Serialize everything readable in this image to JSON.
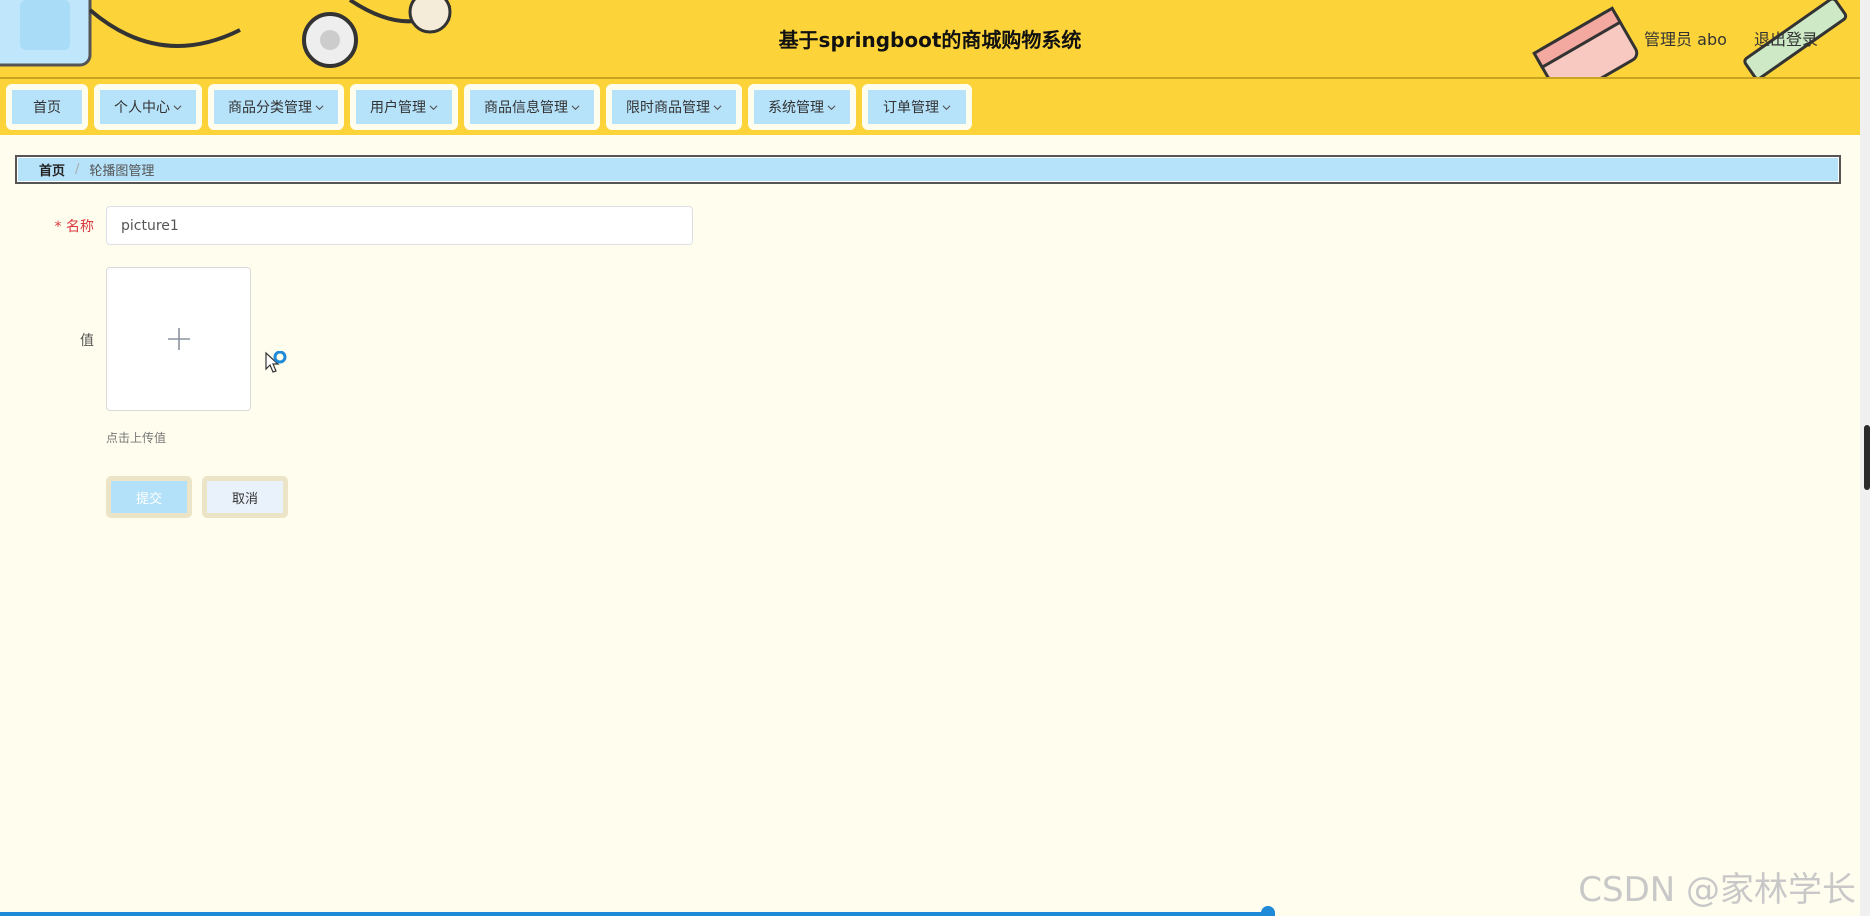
{
  "header": {
    "title": "基于springboot的商城购物系统",
    "user_label": "管理员 abo",
    "logout_label": "退出登录"
  },
  "nav": {
    "items": [
      {
        "label": "首页"
      },
      {
        "label": "个人中心"
      },
      {
        "label": "商品分类管理"
      },
      {
        "label": "用户管理"
      },
      {
        "label": "商品信息管理"
      },
      {
        "label": "限时商品管理"
      },
      {
        "label": "系统管理"
      },
      {
        "label": "订单管理"
      }
    ]
  },
  "breadcrumb": {
    "home": "首页",
    "separator": "/",
    "current": "轮播图管理"
  },
  "form": {
    "name_required_mark": "*",
    "name_label": "名称",
    "name_value": "picture1",
    "value_label": "值",
    "upload_tip": "点击上传值",
    "submit_label": "提交",
    "cancel_label": "取消"
  },
  "watermark": "CSDN @家林学长",
  "colors": {
    "header_bg": "#fcd43a",
    "nav_item_bg": "#b6e2fa",
    "page_bg": "#fffdee",
    "required": "#d9393f"
  }
}
